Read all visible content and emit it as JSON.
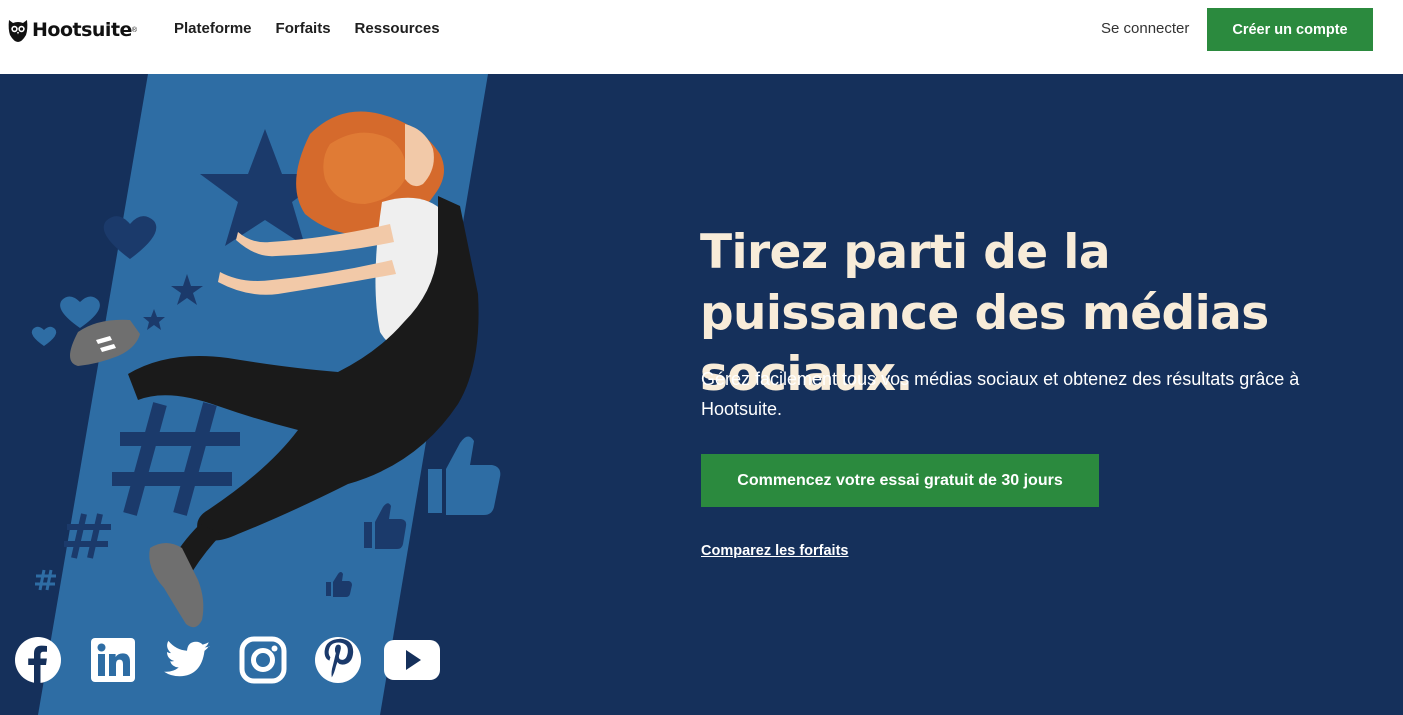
{
  "header": {
    "logo_text": "Hootsuite",
    "logo_mark": "®",
    "nav": [
      {
        "label": "Plateforme",
        "icon": "none"
      },
      {
        "label": "Forfaits",
        "icon": "none"
      },
      {
        "label": "Ressources",
        "icon": "none"
      }
    ],
    "login_label": "Se connecter",
    "signup_label": "Créer un compte"
  },
  "hero": {
    "headline": "Tirez parti de la puissance des médias sociaux.",
    "subtext": "Gérez facilement tous vos médias sociaux et obtenez des résultats grâce à Hootsuite.",
    "cta_label": "Commencez votre essai gratuit de 30 jours",
    "compare_label": "Comparez les forfaits"
  },
  "social_icons": [
    "facebook-icon",
    "linkedin-icon",
    "twitter-icon",
    "instagram-icon",
    "pinterest-icon",
    "youtube-icon"
  ],
  "colors": {
    "brand_green": "#2b8a3e",
    "hero_bg": "#15305b",
    "hero_band": "#2e6da4",
    "headline": "#f8ecd9"
  }
}
